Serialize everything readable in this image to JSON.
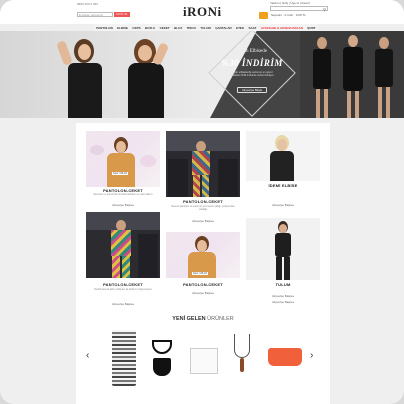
{
  "topbar": {
    "contact": "0850 333 0 333",
    "email_placeholder": "E-bülten adresiniz",
    "email_button": "KAYIT OL",
    "top_links": "Yardım | Giriş | Üye ol | Favori",
    "cart_text": "Sepetim · 0 ürün · 0,00 TL"
  },
  "logo": "iRONi",
  "nav": [
    "PANTOLON",
    "ELBISE",
    "CEPS",
    "BUZLU",
    "CEKET",
    "BLUZ",
    "TRICO",
    "TULUM",
    "ÇANTALAR",
    "ETEK",
    "SAAT",
    "AYAKKABI & AKSESUARLAR",
    "ŞORT"
  ],
  "banner": {
    "subtitle": "Siyah Elbisede",
    "title": "%30 İNDİRİM",
    "description": "Siyah elbiselerde sezonun en güzel modelleri %30 indirimle sizleri bekliyor.",
    "button": "Alışverişe Başla"
  },
  "products": [
    {
      "title": "PANTOLON-CEKET",
      "desc": "Sezonun en şık kombin önerisi pantolon ve ceket takımı",
      "link": "Alışverişe Başla",
      "price": "Spor 115.22"
    },
    {
      "title": "PANTOLON-CEKET",
      "desc": "Desenli pantolon ve ceket ile yeni sezon şıklığı, podyumdan sokağa",
      "link": "Alışverişe Başla",
      "price": ""
    },
    {
      "title": "İDEMİ ELBİSE",
      "desc": "",
      "link": "Alışverişe Başla",
      "price": ""
    },
    {
      "title": "PANTOLON-CEKET",
      "desc": "Renkli desenli takım elbiseler ile farkınızı ortaya koyun",
      "link": "Alışverişe Başla",
      "price": ""
    },
    {
      "title": "PANTOLON-CEKET",
      "desc": "",
      "link": "Alışverişe Başla",
      "price": "Spor 115.22"
    },
    {
      "title": "TULUM",
      "desc": "",
      "link": "Alışverişe Başla",
      "price": ""
    }
  ],
  "section": {
    "bold": "YENİ GELEN",
    "light": "ÜRÜNLER"
  },
  "carousel": {
    "prev": "‹",
    "next": "›"
  },
  "colors": {
    "accent": "#e33333",
    "cart": "#f0a020",
    "banner_dark": "#444444"
  }
}
